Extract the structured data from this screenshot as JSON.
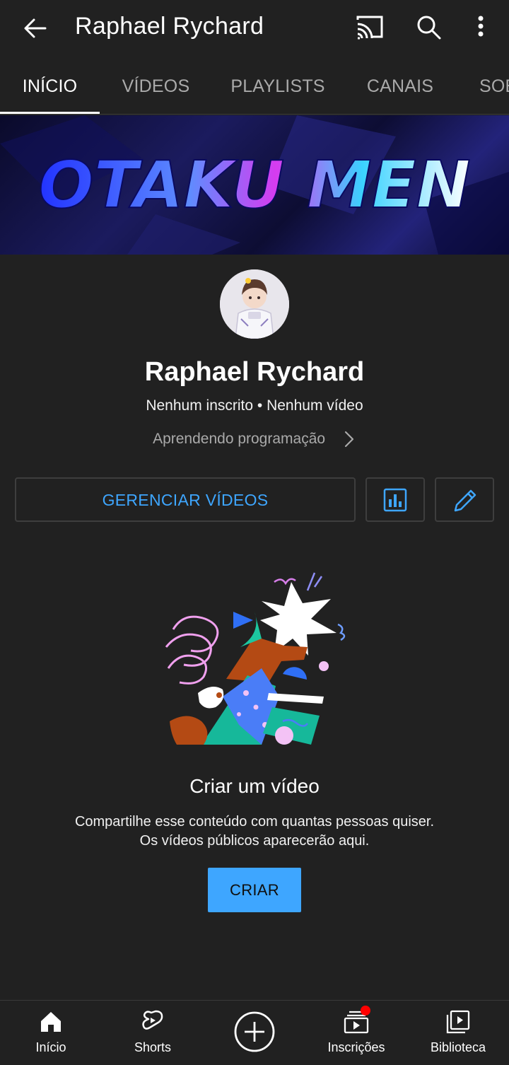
{
  "app_bar": {
    "title": "Raphael Rychard",
    "icons": [
      "back-arrow-icon",
      "cast-icon",
      "search-icon",
      "more-vert-icon"
    ]
  },
  "tabs": [
    {
      "label": "INÍCIO",
      "active": true
    },
    {
      "label": "VÍDEOS",
      "active": false
    },
    {
      "label": "PLAYLISTS",
      "active": false
    },
    {
      "label": "CANAIS",
      "active": false
    },
    {
      "label": "SOBRE",
      "active": false
    }
  ],
  "banner": {
    "text": "OTAKU MEN"
  },
  "channel": {
    "name": "Raphael Rychard",
    "stats": "Nenhum inscrito • Nenhum vídeo",
    "description": "Aprendendo programação"
  },
  "actions": {
    "manage_videos": "GERENCIAR VÍDEOS",
    "analytics_icon": "analytics-icon",
    "edit_icon": "edit-pencil-icon"
  },
  "empty_state": {
    "title": "Criar um vídeo",
    "description_line1": "Compartilhe esse conteúdo com quantas pessoas quiser.",
    "description_line2": "Os vídeos públicos aparecerão aqui.",
    "create_button": "CRIAR"
  },
  "bottom_nav": [
    {
      "label": "Início",
      "icon": "home-icon",
      "active": true
    },
    {
      "label": "Shorts",
      "icon": "shorts-icon"
    },
    {
      "label": "",
      "icon": "create-plus-icon"
    },
    {
      "label": "Inscrições",
      "icon": "subscriptions-icon",
      "has_notification": true
    },
    {
      "label": "Biblioteca",
      "icon": "library-icon"
    }
  ],
  "colors": {
    "background": "#212121",
    "accent_blue": "#3ea6ff",
    "notification_red": "#ff0000",
    "muted_text": "#aaaaaa"
  }
}
